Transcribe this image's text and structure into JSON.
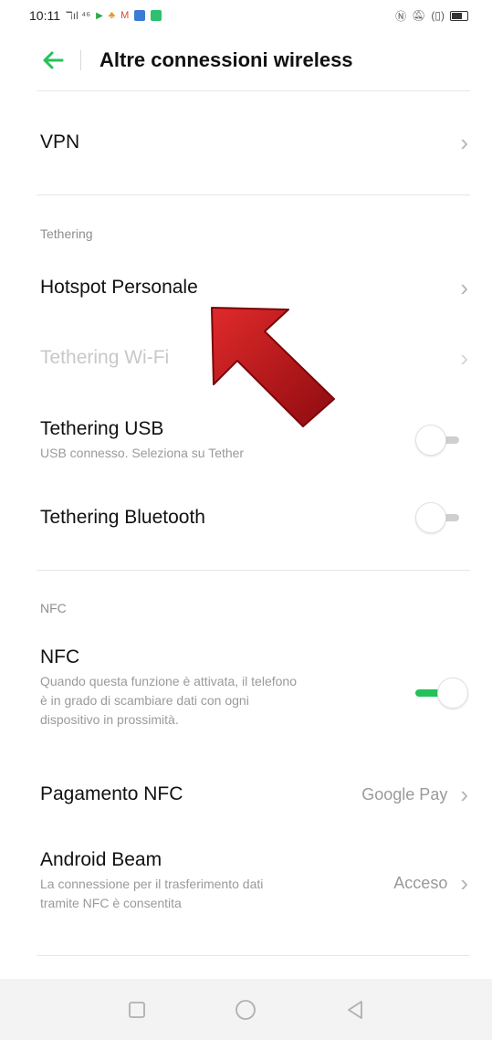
{
  "status_bar": {
    "time": "10:11",
    "left_icons_text": "ℸıl ⁴⁶",
    "right_icons": [
      "nfc-icon",
      "vibrate-icon",
      "battery-icon"
    ]
  },
  "header": {
    "title": "Altre connessioni wireless"
  },
  "rows": {
    "vpn": {
      "title": "VPN"
    },
    "tethering_section": "Tethering",
    "hotspot": {
      "title": "Hotspot Personale"
    },
    "wifi_tethering": {
      "title": "Tethering Wi-Fi",
      "enabled": false
    },
    "usb_tethering": {
      "title": "Tethering USB",
      "subtitle": "USB connesso. Seleziona su Tether",
      "toggle": false
    },
    "bt_tethering": {
      "title": "Tethering Bluetooth",
      "toggle": false
    },
    "nfc_section": "NFC",
    "nfc": {
      "title": "NFC",
      "subtitle_lines": [
        "Quando questa funzione è attivata, il telefono",
        "è in grado di scambiare dati con ogni",
        "dispositivo in prossimità."
      ],
      "toggle": true
    },
    "nfc_payment": {
      "title": "Pagamento NFC",
      "value": "Google Pay"
    },
    "android_beam": {
      "title": "Android Beam",
      "subtitle_lines": [
        "La connessione per il trasferimento dati",
        "tramite NFC è consentita"
      ],
      "value": "Acceso"
    }
  },
  "colors": {
    "accent": "#25c25a",
    "annotation_arrow": "#c4121a"
  }
}
